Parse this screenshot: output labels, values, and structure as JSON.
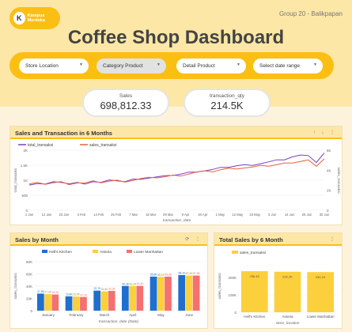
{
  "header": {
    "logo_text": "Kampus Merdeka",
    "group": "Group 20 - Balikpapan",
    "title": "Coffee Shop Dashboard"
  },
  "filters": [
    "Store Location",
    "Category Product",
    "Detail Product",
    "Select date range"
  ],
  "kpis": [
    {
      "label": "Sales",
      "value": "698,812.33"
    },
    {
      "label": "transaction_qty",
      "value": "214.5K"
    }
  ],
  "line_card": {
    "title": "Sales and Transaction in 6 Months",
    "icons": "↑ ↓ ⋮"
  },
  "bar_card": {
    "title": "Sales by Month",
    "icons": "⟳ ⋮"
  },
  "total_card": {
    "title": "Total Sales by 6 Month",
    "icons": "⋮"
  },
  "colors": {
    "purple": "#7b3fbf",
    "orange": "#e8623a",
    "blue": "#1f6fd1",
    "yellow": "#fbd03c",
    "pink": "#f5706f",
    "accent": "#fbbf14"
  },
  "chart_data": [
    {
      "type": "line",
      "title": "Sales and Transaction in 6 Months",
      "xlabel": "transaction_date",
      "ylabel": "total_transaksi",
      "y2label": "sales_transaksi",
      "legend": [
        "total_transaksi",
        "sales_transaksi"
      ],
      "y_ticks": [
        "0",
        "500",
        "1K",
        "1.5K",
        "2K"
      ],
      "y2_ticks": [
        "0",
        "2K",
        "4K",
        "6K"
      ],
      "x_ticks": [
        "1 Jan",
        "12 Jan",
        "23 Jan",
        "3 Feb",
        "14 Feb",
        "25 Feb",
        "7 Mar",
        "18 Mar",
        "29 Mar",
        "9 Apr",
        "20 Apr",
        "1 May",
        "12 May",
        "23 May",
        "3 Jun",
        "14 Jun",
        "25 Jun",
        "30 Jun"
      ],
      "series": [
        {
          "name": "total_transaksi",
          "values": [
            870,
            900,
            860,
            920,
            950,
            880,
            910,
            900,
            960,
            920,
            980,
            1000,
            950,
            1020,
            1060,
            1080,
            1100,
            1120,
            1180,
            1200,
            1250,
            1300,
            1320,
            1350,
            1400,
            1450,
            1480,
            1500,
            1520,
            1560,
            1600,
            1650,
            1700,
            1780,
            1820,
            1850,
            1600,
            1900
          ]
        },
        {
          "name": "sales_transaksi",
          "values": [
            2600,
            2700,
            2650,
            2750,
            2800,
            2650,
            2750,
            2700,
            2850,
            2800,
            2900,
            2950,
            2900,
            3000,
            3150,
            3200,
            3300,
            3350,
            3450,
            3500,
            3650,
            3800,
            3850,
            3900,
            4050,
            4150,
            4200,
            4250,
            4300,
            4400,
            4450,
            4550,
            4650,
            4800,
            4900,
            5000,
            4300,
            5200
          ]
        }
      ]
    },
    {
      "type": "bar",
      "title": "Sales by Month",
      "xlabel": "transaction_date (Date)",
      "ylabel": "sales_transaksi",
      "categories": [
        "January",
        "February",
        "March",
        "April",
        "May",
        "June"
      ],
      "legend": [
        "Hell's Kitchen",
        "Astoria",
        "Lower Manhattan"
      ],
      "y_ticks": [
        "0",
        "20K",
        "40K",
        "60K",
        "80K"
      ],
      "ylim": [
        0,
        80000
      ],
      "series": [
        {
          "name": "Hell's Kitchen",
          "values": [
            27.8,
            23.4,
            32.7,
            40.3,
            55.6,
            58.1
          ],
          "labels": [
            "27,8K",
            "23,4K",
            "32,7K",
            "40,3K",
            "55,6K",
            "58,1K"
          ]
        },
        {
          "name": "Astoria",
          "values": [
            27.0,
            23.0,
            31.6,
            40.2,
            55.1,
            57.4
          ],
          "labels": [
            "27,0K",
            "23,0K",
            "31,6K",
            "40,2K",
            "55,1K",
            "57,4K"
          ]
        },
        {
          "name": "Lower Manhattan",
          "values": [
            26.4,
            22.2,
            32.3,
            40.4,
            55.6,
            57.3
          ],
          "labels": [
            "26,4K",
            "22,2K",
            "32,3K",
            "40,4K",
            "55,6K",
            "57,3K"
          ]
        }
      ]
    },
    {
      "type": "bar",
      "title": "Total Sales by 6 Month",
      "xlabel": "store_location",
      "ylabel": "sales_transaksi",
      "legend": [
        "sales_transaksi"
      ],
      "categories": [
        "Hell's Kitchen",
        "Astoria",
        "Lower Manhattan"
      ],
      "values": [
        236,
        233,
        231
      ],
      "labels": [
        "236.4K",
        "232.2K",
        "230.1K"
      ],
      "y_ticks": [
        "0",
        "100K",
        "200K"
      ],
      "ylim": [
        0,
        300
      ]
    }
  ]
}
